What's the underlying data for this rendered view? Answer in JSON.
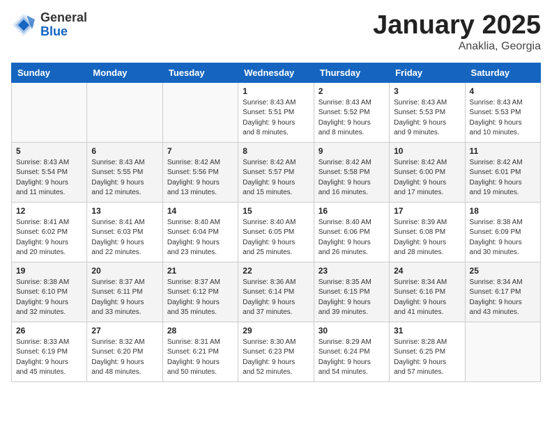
{
  "header": {
    "logo_general": "General",
    "logo_blue": "Blue",
    "main_title": "January 2025",
    "subtitle": "Anaklia, Georgia"
  },
  "calendar": {
    "days_of_week": [
      "Sunday",
      "Monday",
      "Tuesday",
      "Wednesday",
      "Thursday",
      "Friday",
      "Saturday"
    ],
    "weeks": [
      {
        "alt": false,
        "days": [
          {
            "num": "",
            "info": ""
          },
          {
            "num": "",
            "info": ""
          },
          {
            "num": "",
            "info": ""
          },
          {
            "num": "1",
            "info": "Sunrise: 8:43 AM\nSunset: 5:51 PM\nDaylight: 9 hours\nand 8 minutes."
          },
          {
            "num": "2",
            "info": "Sunrise: 8:43 AM\nSunset: 5:52 PM\nDaylight: 9 hours\nand 8 minutes."
          },
          {
            "num": "3",
            "info": "Sunrise: 8:43 AM\nSunset: 5:53 PM\nDaylight: 9 hours\nand 9 minutes."
          },
          {
            "num": "4",
            "info": "Sunrise: 8:43 AM\nSunset: 5:53 PM\nDaylight: 9 hours\nand 10 minutes."
          }
        ]
      },
      {
        "alt": true,
        "days": [
          {
            "num": "5",
            "info": "Sunrise: 8:43 AM\nSunset: 5:54 PM\nDaylight: 9 hours\nand 11 minutes."
          },
          {
            "num": "6",
            "info": "Sunrise: 8:43 AM\nSunset: 5:55 PM\nDaylight: 9 hours\nand 12 minutes."
          },
          {
            "num": "7",
            "info": "Sunrise: 8:42 AM\nSunset: 5:56 PM\nDaylight: 9 hours\nand 13 minutes."
          },
          {
            "num": "8",
            "info": "Sunrise: 8:42 AM\nSunset: 5:57 PM\nDaylight: 9 hours\nand 15 minutes."
          },
          {
            "num": "9",
            "info": "Sunrise: 8:42 AM\nSunset: 5:58 PM\nDaylight: 9 hours\nand 16 minutes."
          },
          {
            "num": "10",
            "info": "Sunrise: 8:42 AM\nSunset: 6:00 PM\nDaylight: 9 hours\nand 17 minutes."
          },
          {
            "num": "11",
            "info": "Sunrise: 8:42 AM\nSunset: 6:01 PM\nDaylight: 9 hours\nand 19 minutes."
          }
        ]
      },
      {
        "alt": false,
        "days": [
          {
            "num": "12",
            "info": "Sunrise: 8:41 AM\nSunset: 6:02 PM\nDaylight: 9 hours\nand 20 minutes."
          },
          {
            "num": "13",
            "info": "Sunrise: 8:41 AM\nSunset: 6:03 PM\nDaylight: 9 hours\nand 22 minutes."
          },
          {
            "num": "14",
            "info": "Sunrise: 8:40 AM\nSunset: 6:04 PM\nDaylight: 9 hours\nand 23 minutes."
          },
          {
            "num": "15",
            "info": "Sunrise: 8:40 AM\nSunset: 6:05 PM\nDaylight: 9 hours\nand 25 minutes."
          },
          {
            "num": "16",
            "info": "Sunrise: 8:40 AM\nSunset: 6:06 PM\nDaylight: 9 hours\nand 26 minutes."
          },
          {
            "num": "17",
            "info": "Sunrise: 8:39 AM\nSunset: 6:08 PM\nDaylight: 9 hours\nand 28 minutes."
          },
          {
            "num": "18",
            "info": "Sunrise: 8:38 AM\nSunset: 6:09 PM\nDaylight: 9 hours\nand 30 minutes."
          }
        ]
      },
      {
        "alt": true,
        "days": [
          {
            "num": "19",
            "info": "Sunrise: 8:38 AM\nSunset: 6:10 PM\nDaylight: 9 hours\nand 32 minutes."
          },
          {
            "num": "20",
            "info": "Sunrise: 8:37 AM\nSunset: 6:11 PM\nDaylight: 9 hours\nand 33 minutes."
          },
          {
            "num": "21",
            "info": "Sunrise: 8:37 AM\nSunset: 6:12 PM\nDaylight: 9 hours\nand 35 minutes."
          },
          {
            "num": "22",
            "info": "Sunrise: 8:36 AM\nSunset: 6:14 PM\nDaylight: 9 hours\nand 37 minutes."
          },
          {
            "num": "23",
            "info": "Sunrise: 8:35 AM\nSunset: 6:15 PM\nDaylight: 9 hours\nand 39 minutes."
          },
          {
            "num": "24",
            "info": "Sunrise: 8:34 AM\nSunset: 6:16 PM\nDaylight: 9 hours\nand 41 minutes."
          },
          {
            "num": "25",
            "info": "Sunrise: 8:34 AM\nSunset: 6:17 PM\nDaylight: 9 hours\nand 43 minutes."
          }
        ]
      },
      {
        "alt": false,
        "days": [
          {
            "num": "26",
            "info": "Sunrise: 8:33 AM\nSunset: 6:19 PM\nDaylight: 9 hours\nand 45 minutes."
          },
          {
            "num": "27",
            "info": "Sunrise: 8:32 AM\nSunset: 6:20 PM\nDaylight: 9 hours\nand 48 minutes."
          },
          {
            "num": "28",
            "info": "Sunrise: 8:31 AM\nSunset: 6:21 PM\nDaylight: 9 hours\nand 50 minutes."
          },
          {
            "num": "29",
            "info": "Sunrise: 8:30 AM\nSunset: 6:23 PM\nDaylight: 9 hours\nand 52 minutes."
          },
          {
            "num": "30",
            "info": "Sunrise: 8:29 AM\nSunset: 6:24 PM\nDaylight: 9 hours\nand 54 minutes."
          },
          {
            "num": "31",
            "info": "Sunrise: 8:28 AM\nSunset: 6:25 PM\nDaylight: 9 hours\nand 57 minutes."
          },
          {
            "num": "",
            "info": ""
          }
        ]
      }
    ]
  }
}
